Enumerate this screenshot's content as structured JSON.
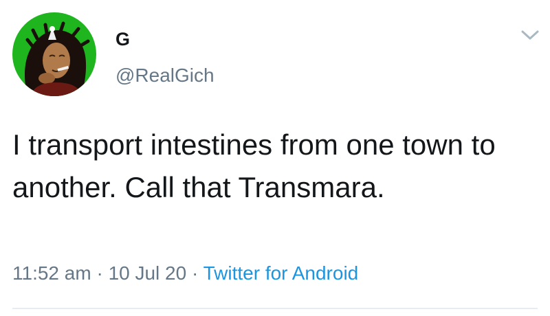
{
  "tweet": {
    "display_name": "G",
    "handle": "@RealGich",
    "text": "I transport intestines from one town to another. Call that Transmara.",
    "time": "11:52 am",
    "date": "10 Jul 20",
    "separator": " · ",
    "source": "Twitter for Android"
  },
  "icons": {
    "avatar": "profile-avatar",
    "menu": "chevron-down-icon"
  },
  "colors": {
    "avatar_background": "#1fb51f",
    "text": "#14171a",
    "secondary_text": "#657786",
    "link": "#1b95e0"
  }
}
